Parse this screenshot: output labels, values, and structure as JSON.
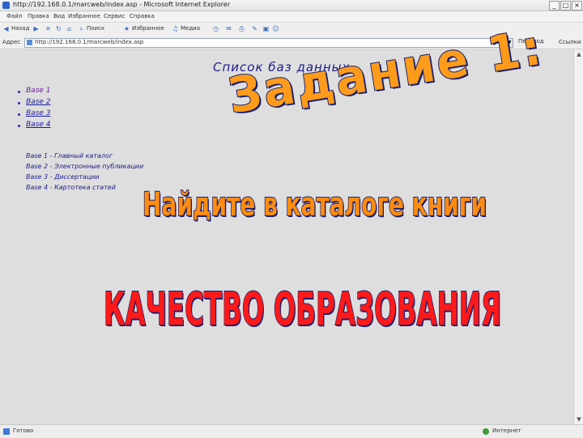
{
  "window": {
    "title": "http://192.168.0.1/marcweb/index.asp - Microsoft Internet Explorer",
    "controls": [
      "_",
      "□",
      "×"
    ]
  },
  "menu": [
    "Файл",
    "Правка",
    "Вид",
    "Избранное",
    "Сервис",
    "Справка"
  ],
  "toolbar": {
    "back_label": "Назад",
    "search_label": "Поиск",
    "favorites_label": "Избранное",
    "media_label": "Медиа"
  },
  "address": {
    "label": "Адрес",
    "url": "http://192.168.0.1/marcweb/index.asp",
    "go_label": "Переход",
    "links_label": "Ссылки"
  },
  "page": {
    "title": "Список баз данных",
    "databases": [
      "Base 1",
      "Base 2",
      "Base 3",
      "Base 4"
    ],
    "legend": [
      "Base 1 - Главный каталог",
      "Base 2 - Электронные публикации",
      "Base 3 - Диссертации",
      "Base 4 - Картотека статей"
    ]
  },
  "overlay": {
    "task": "Задание 1:",
    "instruction": "Найдите в каталоге книги",
    "topic": "КАЧЕСТВО ОБРАЗОВАНИЯ"
  },
  "status": {
    "text": "Готово",
    "zone": "Интернет"
  },
  "colors": {
    "page_bg": "#dedede",
    "link": "#1a1aa0",
    "task_fill": "#ff9b1a",
    "topic_fill": "#ff1a1a",
    "outline": "#1b1f6e"
  }
}
